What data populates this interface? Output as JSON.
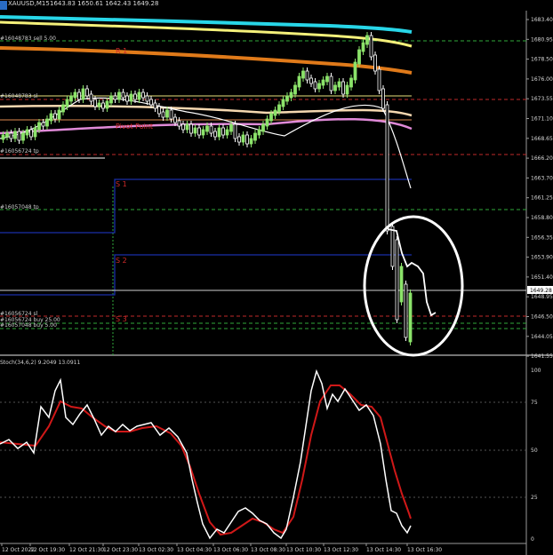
{
  "window": {
    "symbol": "XAUUSD,M15",
    "ohlc": "1643.83 1650.61 1642.43 1649.28"
  },
  "price_axis": [
    "1683.40",
    "1680.95",
    "1678.50",
    "1676.00",
    "1673.55",
    "1671.10",
    "1668.65",
    "1666.20",
    "1663.70",
    "1661.25",
    "1658.80",
    "1656.35",
    "1653.90",
    "1651.40",
    "1648.95",
    "1646.50",
    "1644.05",
    "1641.55"
  ],
  "current_price": "1649.28",
  "levels": {
    "r1": "R 1",
    "pivot": "Pivot Point",
    "s1": "S 1",
    "s2": "S 2",
    "s3": "S 3"
  },
  "order_labels": {
    "sell": "#16048783 sell 5.00",
    "sl1": "#16048783 sl",
    "tp1": "#16056724 tp",
    "tp2": "#16057048 tp",
    "sl2": "#16056724 sl",
    "buy1": "#16056724 buy 25.00",
    "buy2": "#16057048 buy 5.00"
  },
  "stoch": {
    "title": "Stoch(34,6,2) 9.2049 13.0911",
    "axis": [
      "100",
      "75",
      "50",
      "25",
      "0"
    ]
  },
  "time_axis": [
    "12 Oct 2022",
    "12 Oct 19:30",
    "12 Oct 21:30",
    "12 Oct 23:30",
    "13 Oct 02:30",
    "13 Oct 04:30",
    "13 Oct 06:30",
    "13 Oct 08:30",
    "13 Oct 10:30",
    "13 Oct 12:30",
    "13 Oct 14:30",
    "13 Oct 16:30"
  ],
  "colors": {
    "bull_candle": "#8be36a",
    "bear_candle": "#ffffff",
    "ma_cyan": "#28d6e8",
    "ma_yellow": "#f4f07a",
    "ma_orange": "#e07a1a",
    "ma_pink": "#e08ad8",
    "ma_cream": "#f5d8b0",
    "s_line": "#1a2fa8",
    "stoch_main": "#ffffff",
    "stoch_signal": "#d01818",
    "annotation": "#ffffff"
  }
}
